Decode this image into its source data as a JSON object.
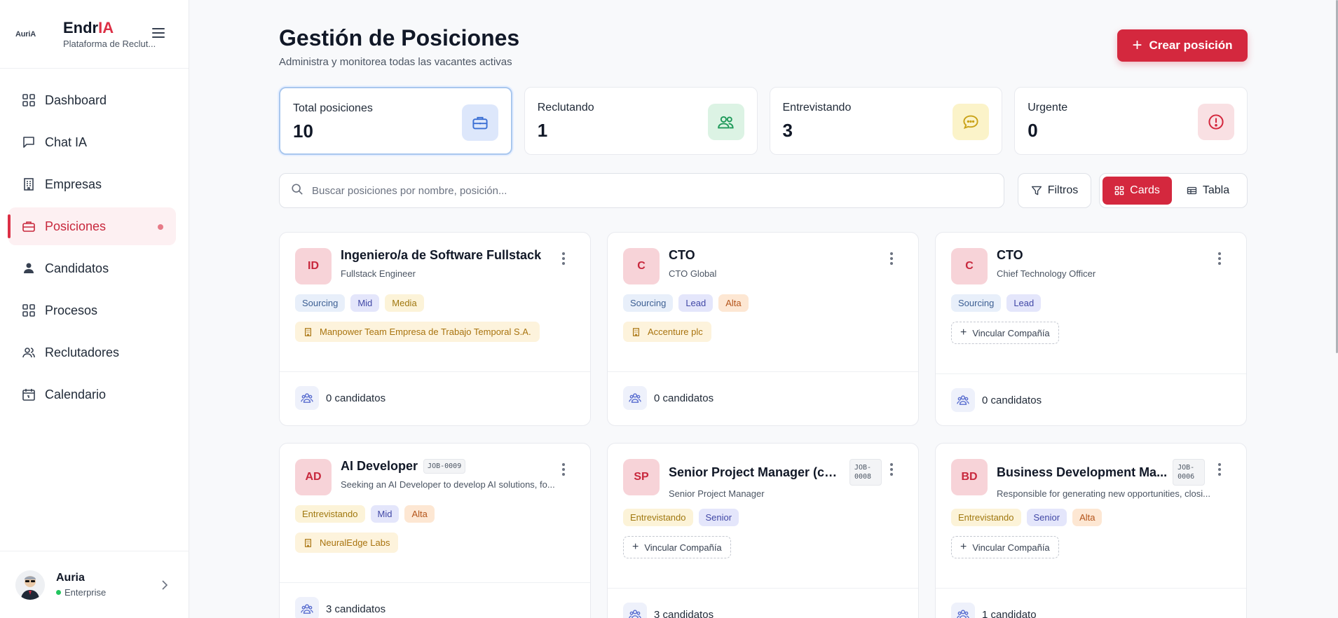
{
  "brand": {
    "logo_text": "AuriA",
    "name_main": "Endr",
    "name_accent": "IA",
    "subtitle": "Plataforma de Reclut..."
  },
  "sidebar": {
    "items": [
      {
        "label": "Dashboard",
        "icon": "grid-icon"
      },
      {
        "label": "Chat IA",
        "icon": "chat-icon"
      },
      {
        "label": "Empresas",
        "icon": "building-icon"
      },
      {
        "label": "Posiciones",
        "icon": "briefcase-icon",
        "active": true
      },
      {
        "label": "Candidatos",
        "icon": "user-icon"
      },
      {
        "label": "Procesos",
        "icon": "grid-icon"
      },
      {
        "label": "Reclutadores",
        "icon": "users-icon"
      },
      {
        "label": "Calendario",
        "icon": "calendar-icon"
      }
    ]
  },
  "user": {
    "name": "Auria",
    "plan": "Enterprise"
  },
  "header": {
    "title": "Gestión de Posiciones",
    "subtitle": "Administra y monitorea todas las vacantes activas",
    "create_label": "Crear posición"
  },
  "stats": [
    {
      "label": "Total posiciones",
      "value": "10",
      "icon": "briefcase-icon",
      "color": "#3b6fd4"
    },
    {
      "label": "Reclutando",
      "value": "1",
      "icon": "users-icon",
      "color": "#1f9a5a"
    },
    {
      "label": "Entrevistando",
      "value": "3",
      "icon": "chat-icon",
      "color": "#c9a218"
    },
    {
      "label": "Urgente",
      "value": "0",
      "icon": "alert-icon",
      "color": "#d4283e"
    }
  ],
  "search": {
    "placeholder": "Buscar posiciones por nombre, posición..."
  },
  "toolbar": {
    "filters_label": "Filtros",
    "cards_label": "Cards",
    "table_label": "Tabla"
  },
  "cards": [
    {
      "initials": "ID",
      "title": "Ingeniero/a de Software Fullstack",
      "subtitle": "Fullstack Engineer",
      "job_code": "",
      "tags": [
        "Sourcing",
        "Mid",
        "Media"
      ],
      "company": "Manpower Team Empresa de Trabajo Temporal S.A.",
      "link_label": "",
      "candidates": "0 candidatos"
    },
    {
      "initials": "C",
      "title": "CTO",
      "subtitle": "CTO Global",
      "job_code": "",
      "tags": [
        "Sourcing",
        "Lead",
        "Alta"
      ],
      "company": "Accenture plc",
      "link_label": "",
      "candidates": "0 candidatos"
    },
    {
      "initials": "C",
      "title": "CTO",
      "subtitle": "Chief Technology Officer",
      "job_code": "",
      "tags": [
        "Sourcing",
        "Lead"
      ],
      "company": "",
      "link_label": "Vincular Compañía",
      "candidates": "0 candidatos"
    },
    {
      "initials": "AD",
      "title": "AI Developer",
      "subtitle": "Seeking an AI Developer to develop AI solutions, fo...",
      "job_code": "JOB-0009",
      "tags": [
        "Entrevistando",
        "Mid",
        "Alta"
      ],
      "company": "NeuralEdge Labs",
      "link_label": "",
      "candidates": "3 candidatos"
    },
    {
      "initials": "SP",
      "title": "Senior Project Manager (con...",
      "subtitle": "Senior Project Manager",
      "job_code_1": "JOB-",
      "job_code_2": "0008",
      "tags": [
        "Entrevistando",
        "Senior"
      ],
      "company": "",
      "link_label": "Vincular Compañía",
      "candidates": "3 candidatos"
    },
    {
      "initials": "BD",
      "title": "Business Development Ma...",
      "subtitle": "Responsible for generating new opportunities, closi...",
      "job_code_1": "JOB-",
      "job_code_2": "0006",
      "tags": [
        "Entrevistando",
        "Senior",
        "Alta"
      ],
      "company": "",
      "link_label": "Vincular Compañía",
      "candidates": "1 candidato"
    }
  ]
}
